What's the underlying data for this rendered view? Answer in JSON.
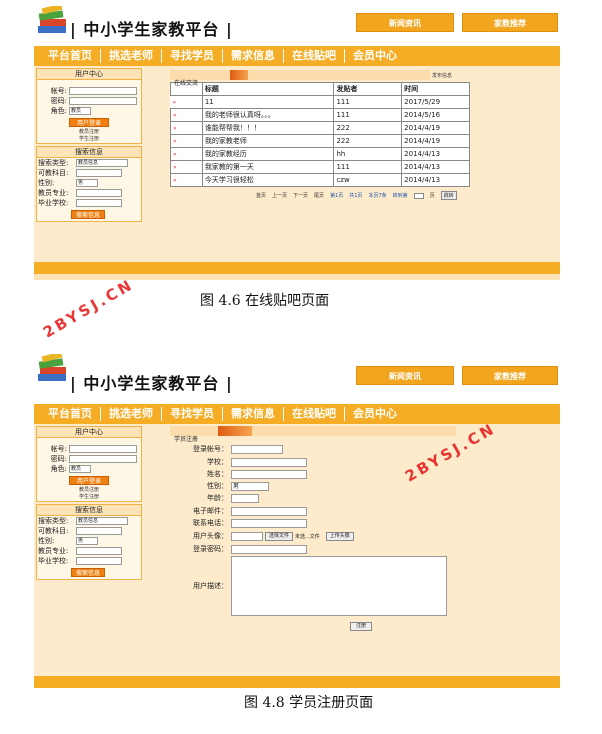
{
  "header": {
    "site_title": "| 中小学生家教平台 |",
    "btn_news": "新闻资讯",
    "btn_recommend": "家教推荐"
  },
  "nav": [
    "平台首页",
    "挑选老师",
    "寻找学员",
    "需求信息",
    "在线贴吧",
    "会员中心"
  ],
  "nav_second": [
    "平台首页",
    "挑选老师",
    "寻找学员",
    "需求信息",
    "在线贴吧",
    "会员中心"
  ],
  "user_center": {
    "title": "用户中心",
    "account_label": "帐号:",
    "password_label": "密码:",
    "role_label": "角色:",
    "role_value": "教员",
    "login_button": "用户登录",
    "teacher_register": "教员注册",
    "student_register": "学生注册"
  },
  "search": {
    "title": "搜索信息",
    "type_label": "搜索类型:",
    "type_value": "教员信息",
    "subject_label": "可教科目:",
    "gender_label": "性别:",
    "gender_value": "男",
    "major_label": "教员专业:",
    "school_label": "毕业学校:",
    "search_button": "搜索信息"
  },
  "forum": {
    "tab_label": "在线交流",
    "more_link": "发布信息",
    "columns": [
      "标题",
      "发贴者",
      "时间"
    ],
    "rows": [
      {
        "title": "11",
        "author": "111",
        "time": "2017/5/29"
      },
      {
        "title": "我的老师很认真呀。。。",
        "author": "111",
        "time": "2014/5/16"
      },
      {
        "title": "谁能帮帮我！！！",
        "author": "222",
        "time": "2014/4/19"
      },
      {
        "title": "我的家教老师",
        "author": "222",
        "time": "2014/4/19"
      },
      {
        "title": "我的家教经历",
        "author": "hh",
        "time": "2014/4/13"
      },
      {
        "title": "我家教的第一天",
        "author": "111",
        "time": "2014/4/13"
      },
      {
        "title": "今天学习很轻松",
        "author": "czw",
        "time": "2014/4/13"
      }
    ],
    "pager": {
      "first": "首页",
      "prev": "上一页",
      "next": "下一页",
      "last": "尾页",
      "page_of": "第1页",
      "total_pages": "共1页",
      "records": "本页7条",
      "goto": "转到第",
      "page_unit": "页",
      "jump": "跳转"
    }
  },
  "caption1": "图 4.6  在线贴吧页面",
  "register": {
    "tab_label": "学员注册",
    "login_account": "登录帐号：",
    "school": "学校：",
    "name": "姓名：",
    "gender": "性别：",
    "gender_value": "男",
    "age": "年龄：",
    "email": "电子邮件：",
    "phone": "联系电话：",
    "avatar": "用户头像：",
    "choose_file": "选择文件",
    "no_file": "未选...文件",
    "upload_avatar": "上传头像",
    "password": "登录密码：",
    "description": "用户描述：",
    "submit": "注册"
  },
  "caption2": "图 4.8  学员注册页面",
  "watermark": "2BYSJ.CN",
  "colors": {
    "nav": "#f4ad25",
    "body": "#fdebcc",
    "button": "#f08010"
  }
}
